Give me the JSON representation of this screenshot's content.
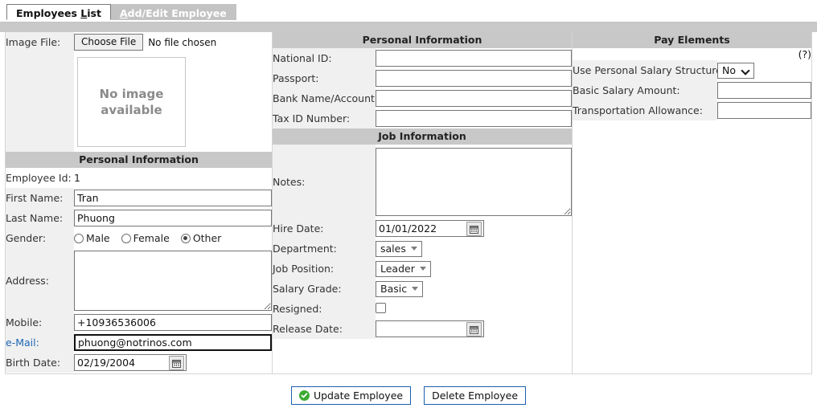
{
  "tabs": [
    {
      "label_pre": "Employees ",
      "label_accesskey": "L",
      "label_post": "ist",
      "active": true
    },
    {
      "label_pre": "",
      "label_accesskey": "A",
      "label_post": "dd/Edit Employee",
      "active": false
    }
  ],
  "left": {
    "image_file_label": "Image File:",
    "choose_file_button": "Choose File",
    "file_status": "No file chosen",
    "no_image_text": "No image\navailable",
    "no_image_line1": "No image",
    "no_image_line2": "available",
    "section_title": "Personal Information",
    "employee_id_label": "Employee Id:",
    "employee_id_value": "1",
    "first_name_label": "First Name:",
    "first_name_value": "Tran",
    "last_name_label": "Last Name:",
    "last_name_value": "Phuong",
    "gender_label": "Gender:",
    "gender_options": [
      {
        "label": "Male",
        "selected": false
      },
      {
        "label": "Female",
        "selected": false
      },
      {
        "label": "Other",
        "selected": true
      }
    ],
    "address_label": "Address:",
    "address_value": "",
    "mobile_label": "Mobile:",
    "mobile_value": "+10936536006",
    "email_label": "e-Mail:",
    "email_value": "phuong@notrinos.com",
    "birth_date_label": "Birth Date:",
    "birth_date_value": "02/19/2004"
  },
  "middle": {
    "personal_section_title": "Personal Information",
    "national_id_label": "National ID:",
    "national_id_value": "",
    "passport_label": "Passport:",
    "passport_value": "",
    "bank_label": "Bank Name/Account:",
    "bank_value": "",
    "tax_id_label": "Tax ID Number:",
    "tax_id_value": "",
    "job_section_title": "Job Information",
    "notes_label": "Notes:",
    "notes_value": "",
    "hire_date_label": "Hire Date:",
    "hire_date_value": "01/01/2022",
    "department_label": "Department:",
    "department_value": "sales",
    "job_position_label": "Job Position:",
    "job_position_value": "Leader",
    "salary_grade_label": "Salary Grade:",
    "salary_grade_value": "Basic",
    "resigned_label": "Resigned:",
    "resigned_checked": false,
    "release_date_label": "Release Date:",
    "release_date_value": ""
  },
  "right": {
    "section_title": "Pay Elements",
    "help_marker": "(?)",
    "use_personal_salary_label": "Use Personal Salary Structure:",
    "use_personal_salary_value": "No",
    "basic_salary_label": "Basic Salary Amount:",
    "basic_salary_value": "",
    "transportation_label": "Transportation Allowance:",
    "transportation_value": ""
  },
  "footer": {
    "update_button": "Update Employee",
    "delete_button": "Delete Employee"
  },
  "colors": {
    "section_header_bg": "#c8c8c8",
    "label_bg": "#f0f0f0",
    "link": "#1b66b5",
    "button_border": "#1b5fb0",
    "ok_green": "#3cab32",
    "tab_inactive_bg": "#c3c3c3"
  }
}
